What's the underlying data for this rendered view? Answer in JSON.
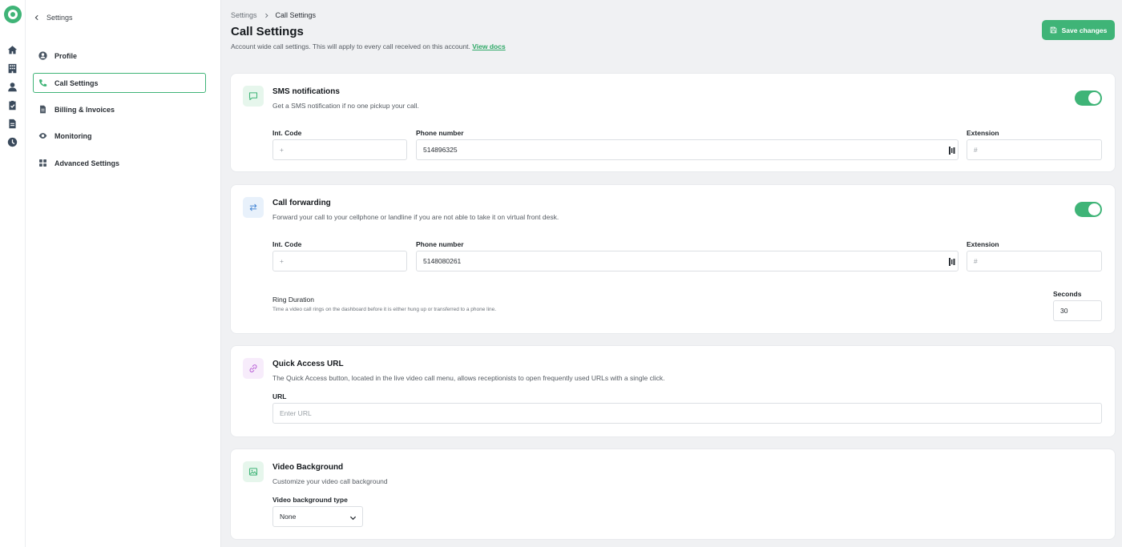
{
  "sidebar": {
    "back_label": "Settings",
    "items": [
      {
        "label": "Profile",
        "icon": "user-circle-icon"
      },
      {
        "label": "Call Settings",
        "icon": "phone-icon"
      },
      {
        "label": "Billing & Invoices",
        "icon": "document-icon"
      },
      {
        "label": "Monitoring",
        "icon": "eye-icon"
      },
      {
        "label": "Advanced Settings",
        "icon": "grid-icon"
      }
    ],
    "active_item": "Call Settings"
  },
  "rail": {
    "icons": [
      "home-icon",
      "building-icon",
      "person-icon",
      "clipboard-check-icon",
      "file-icon",
      "clock-icon"
    ]
  },
  "breadcrumb": {
    "parent": "Settings",
    "current": "Call Settings"
  },
  "page": {
    "title": "Call Settings",
    "subtitle": "Account wide call settings. This will apply to every call received on this account.",
    "docs_link": "View docs",
    "save_label": "Save changes"
  },
  "sms": {
    "title": "SMS notifications",
    "description": "Get a SMS notification if no one pickup your call.",
    "enabled": true,
    "int_code_label": "Int. Code",
    "int_code_placeholder": "+",
    "phone_label": "Phone number",
    "phone_value": "514896325",
    "extension_label": "Extension",
    "extension_placeholder": "#"
  },
  "forwarding": {
    "title": "Call forwarding",
    "description": "Forward your call to your cellphone or landline if you are not able to take it on virtual front desk.",
    "enabled": true,
    "int_code_label": "Int. Code",
    "int_code_placeholder": "+",
    "phone_label": "Phone number",
    "phone_value": "5148080261",
    "extension_label": "Extension",
    "extension_placeholder": "#",
    "ring_title": "Ring Duration",
    "ring_description": "Time a video call rings on the dashboard before it is either hung up or transferred to a phone line.",
    "seconds_label": "Seconds",
    "seconds_value": "30"
  },
  "quick_access": {
    "title": "Quick Access URL",
    "description": "The Quick Access button, located in the live video call menu, allows receptionists to open frequently used URLs with a single click.",
    "url_label": "URL",
    "url_placeholder": "Enter URL"
  },
  "video_background": {
    "title": "Video Background",
    "description": "Customize your video call background",
    "type_label": "Video background type",
    "type_value": "None"
  },
  "colors": {
    "accent": "#3fb477",
    "link": "#2ea866",
    "background": "#f0f1f3"
  }
}
